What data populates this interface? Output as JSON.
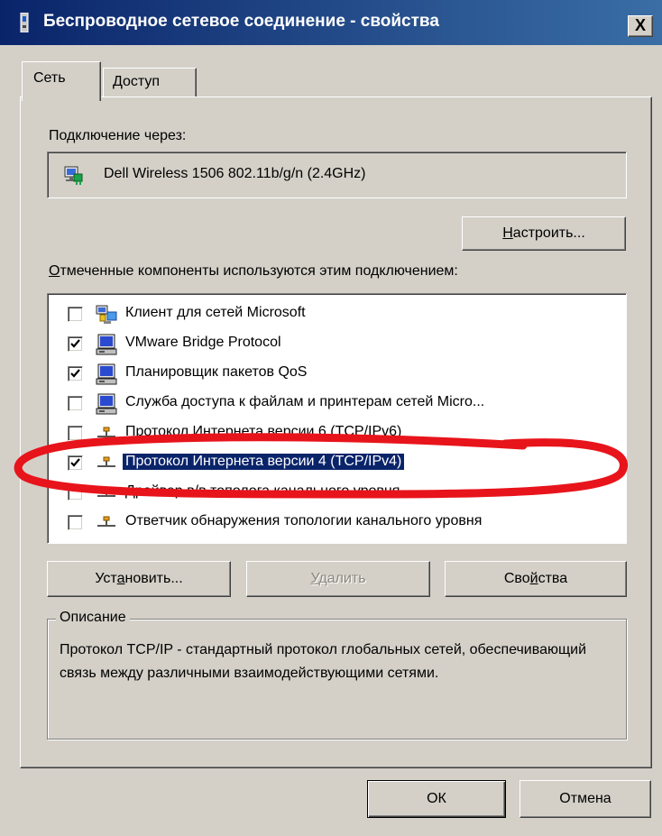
{
  "window": {
    "title": "Беспроводное сетевое соединение - свойства",
    "close_label": "X"
  },
  "tabs": [
    {
      "label": "Сеть",
      "active": true
    },
    {
      "label": "Доступ",
      "active": false
    }
  ],
  "connect_using": {
    "label": "Подключение через:",
    "adapter_name": "Dell Wireless 1506 802.11b/g/n (2.4GHz)",
    "adapter_icon": "network-adapter-icon"
  },
  "configure_button": {
    "pre": "",
    "mnemonic": "Н",
    "post": "астроить..."
  },
  "components": {
    "label_mnemonic": "О",
    "label_rest": "тмеченные компоненты используются этим подключением:",
    "items": [
      {
        "label": "Клиент для сетей Microsoft",
        "checked": false,
        "icon": "network-client-icon"
      },
      {
        "label": "VMware Bridge Protocol",
        "checked": true,
        "icon": "network-service-icon"
      },
      {
        "label": "Планировщик пакетов QoS",
        "checked": true,
        "icon": "network-service-icon"
      },
      {
        "label": "Служба доступа к файлам и принтерам сетей Micro...",
        "checked": false,
        "icon": "network-service-icon"
      },
      {
        "label": "Протокол Интернета версии 6 (TCP/IPv6)",
        "checked": false,
        "icon": "protocol-icon"
      },
      {
        "label": "Протокол Интернета версии 4 (TCP/IPv4)",
        "checked": true,
        "icon": "protocol-icon",
        "selected": true
      },
      {
        "label": "Драйвер в/в тополога канального уровня",
        "checked": false,
        "icon": "protocol-icon"
      },
      {
        "label": "Ответчик обнаружения топологии канального уровня",
        "checked": false,
        "icon": "protocol-icon"
      }
    ]
  },
  "buttons": {
    "install": {
      "pre": "Уст",
      "mnemonic": "а",
      "post": "новить..."
    },
    "uninstall": {
      "pre": "",
      "mnemonic": "У",
      "post": "далить"
    },
    "properties": {
      "pre": "Сво",
      "mnemonic": "й",
      "post": "ства"
    }
  },
  "description": {
    "legend": "Описание",
    "text": "Протокол TCP/IP - стандартный протокол глобальных сетей, обеспечивающий связь между различными взаимодействующими сетями."
  },
  "footer": {
    "ok_label": "ОК",
    "cancel_label": "Отмена"
  },
  "colors": {
    "title_bar": "#0a246a",
    "selection": "#0a246a",
    "annotation": "#e8141b",
    "face": "#d4d0c8"
  }
}
